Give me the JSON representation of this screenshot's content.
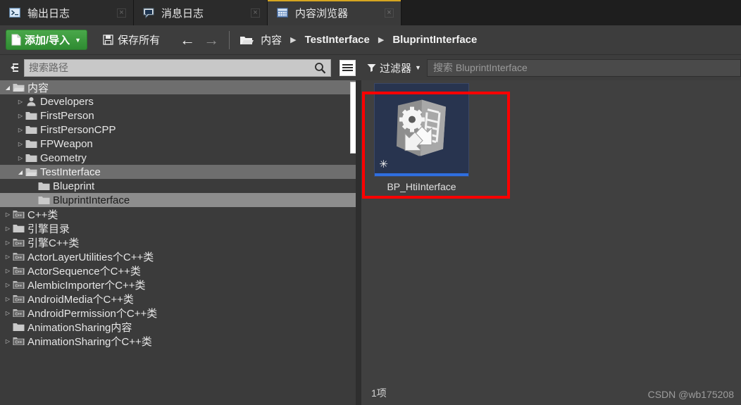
{
  "window": {
    "tabs": [
      {
        "label": "输出日志",
        "icon": "terminal-icon",
        "active": false
      },
      {
        "label": "消息日志",
        "icon": "speech-bubble-icon",
        "active": false
      },
      {
        "label": "内容浏览器",
        "icon": "grid-panel-icon",
        "active": true
      }
    ],
    "close_glyph": "×"
  },
  "toolbar": {
    "add_import_label": "添加/导入",
    "add_import_caret": "▼",
    "save_all_label": "保存所有",
    "back_arrow": "←",
    "forward_arrow": "→",
    "breadcrumb": [
      {
        "label": "内容",
        "bold": false
      },
      {
        "label": "TestInterface",
        "bold": true
      },
      {
        "label": "BluprintInterface",
        "bold": true
      }
    ],
    "breadcrumb_separator": "▶"
  },
  "left_panel": {
    "search_placeholder": "搜索路径",
    "search_value": "",
    "search_icon": "magnifier-icon",
    "view_options_icon": "list-view-icon",
    "collapse_icon": "collapse-tree-icon",
    "tree": [
      {
        "label": "内容",
        "indent": 0,
        "icon": "folder-open-icon",
        "twisty": "open",
        "state": "selected-dark"
      },
      {
        "label": "Developers",
        "indent": 1,
        "icon": "developer-icon",
        "twisty": "closed",
        "state": "none"
      },
      {
        "label": "FirstPerson",
        "indent": 1,
        "icon": "folder-icon",
        "twisty": "closed",
        "state": "none"
      },
      {
        "label": "FirstPersonCPP",
        "indent": 1,
        "icon": "folder-icon",
        "twisty": "closed",
        "state": "none"
      },
      {
        "label": "FPWeapon",
        "indent": 1,
        "icon": "folder-icon",
        "twisty": "closed",
        "state": "none"
      },
      {
        "label": "Geometry",
        "indent": 1,
        "icon": "folder-icon",
        "twisty": "closed",
        "state": "none"
      },
      {
        "label": "TestInterface",
        "indent": 1,
        "icon": "folder-open-icon",
        "twisty": "open",
        "state": "selected-dark"
      },
      {
        "label": "Blueprint",
        "indent": 2,
        "icon": "folder-icon",
        "twisty": "none",
        "state": "none"
      },
      {
        "label": "BluprintInterface",
        "indent": 2,
        "icon": "folder-icon",
        "twisty": "none",
        "state": "selected-light"
      },
      {
        "label": "C++类",
        "indent": 0,
        "icon": "cpp-folder-icon",
        "twisty": "closed",
        "state": "none"
      },
      {
        "label": "引擎目录",
        "indent": 0,
        "icon": "folder-icon",
        "twisty": "closed",
        "state": "none"
      },
      {
        "label": "引擎C++类",
        "indent": 0,
        "icon": "cpp-folder-icon",
        "twisty": "closed",
        "state": "none"
      },
      {
        "label": "ActorLayerUtilities个C++类",
        "indent": 0,
        "icon": "cpp-folder-icon",
        "twisty": "closed",
        "state": "none"
      },
      {
        "label": "ActorSequence个C++类",
        "indent": 0,
        "icon": "cpp-folder-icon",
        "twisty": "closed",
        "state": "none"
      },
      {
        "label": "AlembicImporter个C++类",
        "indent": 0,
        "icon": "cpp-folder-icon",
        "twisty": "closed",
        "state": "none"
      },
      {
        "label": "AndroidMedia个C++类",
        "indent": 0,
        "icon": "cpp-folder-icon",
        "twisty": "closed",
        "state": "none"
      },
      {
        "label": "AndroidPermission个C++类",
        "indent": 0,
        "icon": "cpp-folder-icon",
        "twisty": "closed",
        "state": "none"
      },
      {
        "label": "AnimationSharing内容",
        "indent": 0,
        "icon": "folder-icon",
        "twisty": "none",
        "state": "none"
      },
      {
        "label": "AnimationSharing个C++类",
        "indent": 0,
        "icon": "cpp-folder-icon",
        "twisty": "closed",
        "state": "none"
      }
    ]
  },
  "right_panel": {
    "filter_label": "过滤器",
    "filter_caret": "▼",
    "filter_icon": "funnel-icon",
    "search_placeholder": "搜索 BluprintInterface",
    "search_value": "",
    "assets": [
      {
        "name": "BP_HtiInterface",
        "type": "blueprint-interface",
        "thumbnail_bg": "#28344f",
        "accent": "#2f6fe0",
        "badge": "✳"
      }
    ],
    "status_count": "1项"
  },
  "annotation": {
    "highlight_color": "#fe0000"
  },
  "watermark": "CSDN @wb175208",
  "colors": {
    "tab_active_bg": "#3a3a3a",
    "tab_accent": "#d6a520",
    "toolbar_bg": "#3d3d3d",
    "tree_bg": "#3b3b3b",
    "assets_bg": "#404040",
    "add_button_green": "#3a9e3a",
    "selection_light": "#8d8d8d",
    "selection_dark": "#6e6e6e"
  }
}
